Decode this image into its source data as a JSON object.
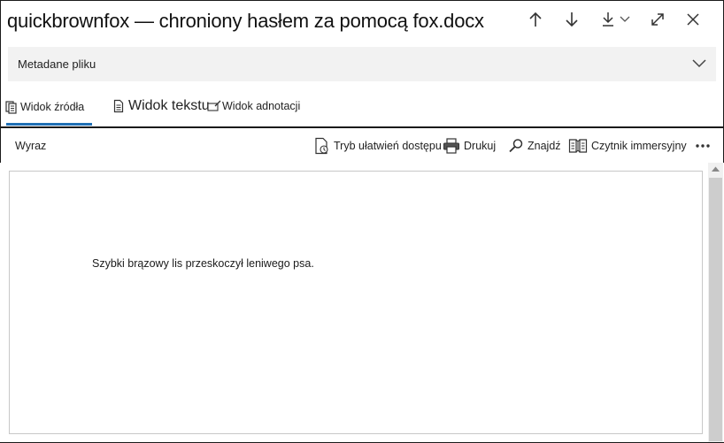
{
  "window": {
    "title": "quickbrownfox — chroniony hasłem za pomocą fox.docx"
  },
  "metadata": {
    "label": "Metadane pliku"
  },
  "tabs": [
    {
      "label": "Widok źródła",
      "icon": "document-icon",
      "active": true
    },
    {
      "label": "Widok tekstu",
      "icon": "text-file-icon",
      "active": false
    },
    {
      "label": "Widok adnotacji",
      "icon": "annotation-icon",
      "active": false
    }
  ],
  "toolbar": {
    "left_label": "Wyraz",
    "accessibility_label": "Tryb ułatwień dostępu",
    "print_label": "Drukuj",
    "find_label": "Znajdź",
    "immersive_label": "Czytnik immersyjny",
    "more_icon": "more-icon"
  },
  "document": {
    "text": "Szybki brązowy lis przeskoczył leniwego psa."
  },
  "colors": {
    "accent": "#1f6fb4",
    "metadata_bg": "#f2f2f2",
    "scrollbar": "#cdcdcd"
  }
}
